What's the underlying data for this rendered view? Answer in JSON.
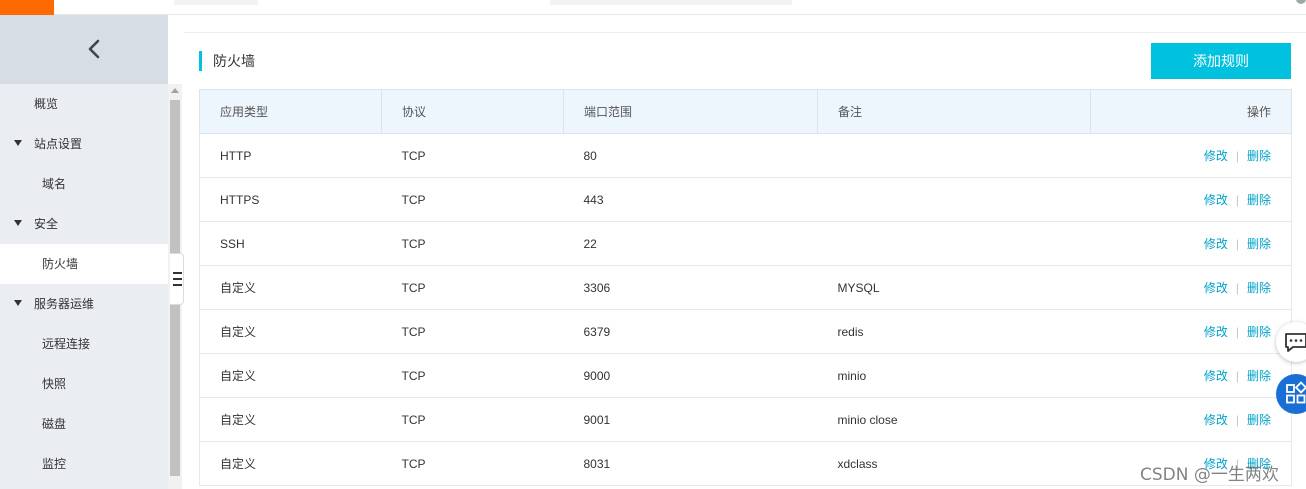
{
  "sidebar": {
    "items": [
      {
        "label": "概览",
        "level": "top",
        "expandable": false,
        "active": false
      },
      {
        "label": "站点设置",
        "level": "top",
        "expandable": true,
        "active": false
      },
      {
        "label": "域名",
        "level": "sub",
        "expandable": false,
        "active": false
      },
      {
        "label": "安全",
        "level": "top",
        "expandable": true,
        "active": false
      },
      {
        "label": "防火墙",
        "level": "sub",
        "expandable": false,
        "active": true
      },
      {
        "label": "服务器运维",
        "level": "top",
        "expandable": true,
        "active": false
      },
      {
        "label": "远程连接",
        "level": "sub",
        "expandable": false,
        "active": false
      },
      {
        "label": "快照",
        "level": "sub",
        "expandable": false,
        "active": false
      },
      {
        "label": "磁盘",
        "level": "sub",
        "expandable": false,
        "active": false
      },
      {
        "label": "监控",
        "level": "sub",
        "expandable": false,
        "active": false
      }
    ]
  },
  "main": {
    "section_title": "防火墙",
    "add_rule_button": "添加规则",
    "table": {
      "headers": [
        "应用类型",
        "协议",
        "端口范围",
        "备注",
        "操作"
      ],
      "rows": [
        {
          "type": "HTTP",
          "protocol": "TCP",
          "port": "80",
          "note": ""
        },
        {
          "type": "HTTPS",
          "protocol": "TCP",
          "port": "443",
          "note": ""
        },
        {
          "type": "SSH",
          "protocol": "TCP",
          "port": "22",
          "note": ""
        },
        {
          "type": "自定义",
          "protocol": "TCP",
          "port": "3306",
          "note": "MYSQL"
        },
        {
          "type": "自定义",
          "protocol": "TCP",
          "port": "6379",
          "note": "redis"
        },
        {
          "type": "自定义",
          "protocol": "TCP",
          "port": "9000",
          "note": "minio"
        },
        {
          "type": "自定义",
          "protocol": "TCP",
          "port": "9001",
          "note": "minio close"
        },
        {
          "type": "自定义",
          "protocol": "TCP",
          "port": "8031",
          "note": "xdclass"
        }
      ],
      "edit_label": "修改",
      "separator": "|",
      "delete_label": "删除"
    }
  },
  "watermark": "CSDN @一生两欢",
  "colors": {
    "accent": "#00c1de",
    "link": "#00a2ca",
    "brand": "#ff6a00",
    "sidebar_bg": "#eaedf1",
    "header_bg": "#eef6fd",
    "float_button": "#1a6fd6"
  },
  "icons": {
    "collapse": "chevron-left-icon",
    "expand_caret": "caret-down-icon",
    "sidebar_toggle": "menu-lines-icon",
    "chat": "chat-bubble-icon",
    "apps": "apps-grid-icon"
  }
}
